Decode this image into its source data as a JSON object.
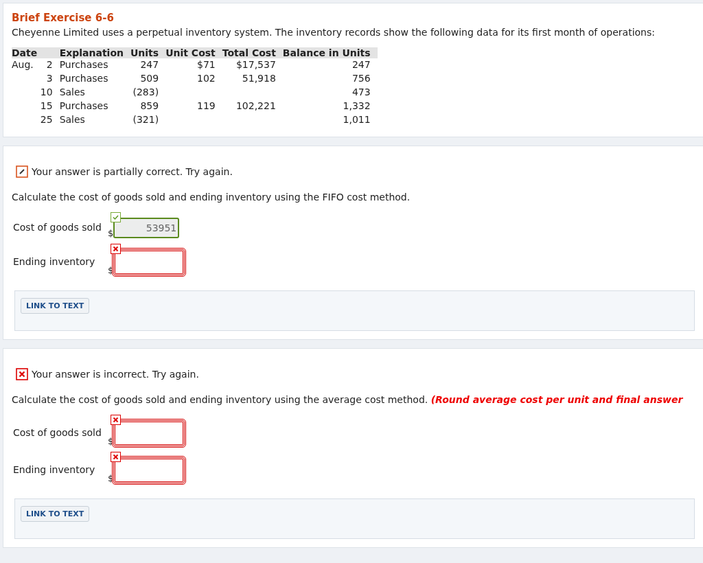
{
  "exercise": {
    "title": "Brief Exercise 6-6",
    "description": "Cheyenne Limited uses a perpetual inventory system. The inventory records show the following data for its first month of operations:",
    "table": {
      "columns": [
        "Date",
        "Explanation",
        "Units",
        "Unit Cost",
        "Total Cost",
        "Balance in Units"
      ],
      "rows": [
        {
          "month": "Aug.",
          "day": "2",
          "explanation": "Purchases",
          "units": "247",
          "unit_cost": "$71",
          "total_cost": "$17,537",
          "balance": "247"
        },
        {
          "day": "3",
          "explanation": "Purchases",
          "units": "509",
          "unit_cost": "102",
          "total_cost": "51,918",
          "balance": "756"
        },
        {
          "day": "10",
          "explanation": "Sales",
          "units": "(283)",
          "balance": "473"
        },
        {
          "day": "15",
          "explanation": "Purchases",
          "units": "859",
          "unit_cost": "119",
          "total_cost": "102,221",
          "balance": "1,332"
        },
        {
          "day": "25",
          "explanation": "Sales",
          "units": "(321)",
          "balance": "1,011"
        }
      ]
    }
  },
  "parts": [
    {
      "kind": "partial",
      "feedback": "Your answer is partially correct.  Try again.",
      "instruction": "Calculate the cost of goods sold and ending inventory using the FIFO cost method.",
      "fields": [
        {
          "label": "Cost of goods sold",
          "currency": "$",
          "correct": true,
          "value": "53951"
        },
        {
          "label": "Ending inventory",
          "currency": "$",
          "correct": false
        }
      ],
      "link": "LINK TO TEXT"
    },
    {
      "kind": "incorrect",
      "feedback": "Your answer is incorrect.  Try again.",
      "instruction": "Calculate the cost of goods sold and ending inventory using the average cost method. **(Round average cost per unit and final answer**",
      "fields": [
        {
          "label": "Cost of goods sold",
          "currency": "$",
          "correct": false
        },
        {
          "label": "Ending inventory",
          "currency": "$",
          "correct": false
        }
      ],
      "link": "LINK TO TEXT"
    }
  ]
}
